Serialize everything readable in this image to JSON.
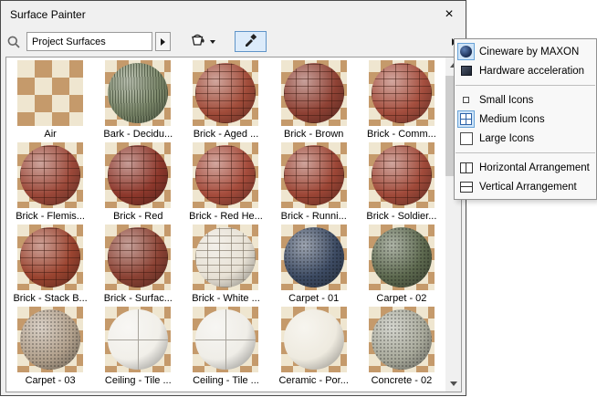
{
  "window": {
    "title": "Surface Painter",
    "close_glyph": "×"
  },
  "toolbar": {
    "source_value": "Project Surfaces"
  },
  "colors": {
    "checker_dark": "#c59a6b",
    "checker_light": "#efe6d0",
    "accent": "#2c62a8"
  },
  "menu": {
    "items": [
      {
        "label": "Cineware by MAXON",
        "icon": "cineware-icon",
        "selected": true
      },
      {
        "label": "Hardware acceleration",
        "icon": "hardware-acceleration-icon",
        "selected": false
      },
      {
        "separator": true
      },
      {
        "label": "Small Icons",
        "icon": "small-icons-icon",
        "selected": false
      },
      {
        "label": "Medium Icons",
        "icon": "medium-icons-icon",
        "selected": true
      },
      {
        "label": "Large Icons",
        "icon": "large-icons-icon",
        "selected": false
      },
      {
        "separator": true
      },
      {
        "label": "Horizontal Arrangement",
        "icon": "horizontal-arrangement-icon",
        "selected": false
      },
      {
        "label": "Vertical Arrangement",
        "icon": "vertical-arrangement-icon",
        "selected": false
      }
    ]
  },
  "surfaces": {
    "items": [
      {
        "label": "Air",
        "style": "checker",
        "color": ""
      },
      {
        "label": "Bark - Decidu...",
        "style": "bark",
        "color": "#7e8a6d"
      },
      {
        "label": "Brick - Aged ...",
        "style": "brick",
        "color": "#a14c3a"
      },
      {
        "label": "Brick - Brown",
        "style": "brick",
        "color": "#8e4134"
      },
      {
        "label": "Brick - Comm...",
        "style": "brick",
        "color": "#a44e3e"
      },
      {
        "label": "Brick - Flemis...",
        "style": "brick",
        "color": "#9b4839"
      },
      {
        "label": "Brick - Red",
        "style": "brick",
        "color": "#8d382c"
      },
      {
        "label": "Brick - Red He...",
        "style": "brick",
        "color": "#a54c3c"
      },
      {
        "label": "Brick - Runni...",
        "style": "brick",
        "color": "#9c4636"
      },
      {
        "label": "Brick - Soldier...",
        "style": "brick",
        "color": "#a04a3a"
      },
      {
        "label": "Brick - Stack B...",
        "style": "brick",
        "color": "#9a4430"
      },
      {
        "label": "Brick - Surfac...",
        "style": "brick",
        "color": "#8b4234"
      },
      {
        "label": "Brick - White ...",
        "style": "brick-white",
        "color": "#e7e1d5"
      },
      {
        "label": "Carpet - 01",
        "style": "speckle",
        "color": "#3d4b63"
      },
      {
        "label": "Carpet - 02",
        "style": "speckle",
        "color": "#5d694f"
      },
      {
        "label": "Carpet - 03",
        "style": "speckle",
        "color": "#b2a18d"
      },
      {
        "label": "Ceiling - Tile ...",
        "style": "cross",
        "color": "#f1efe9"
      },
      {
        "label": "Ceiling - Tile ...",
        "style": "cross",
        "color": "#efede7"
      },
      {
        "label": "Ceramic - Por...",
        "style": "smooth",
        "color": "#eeeadf"
      },
      {
        "label": "Concrete - 02",
        "style": "speckle",
        "color": "#a9aa9c"
      }
    ]
  }
}
